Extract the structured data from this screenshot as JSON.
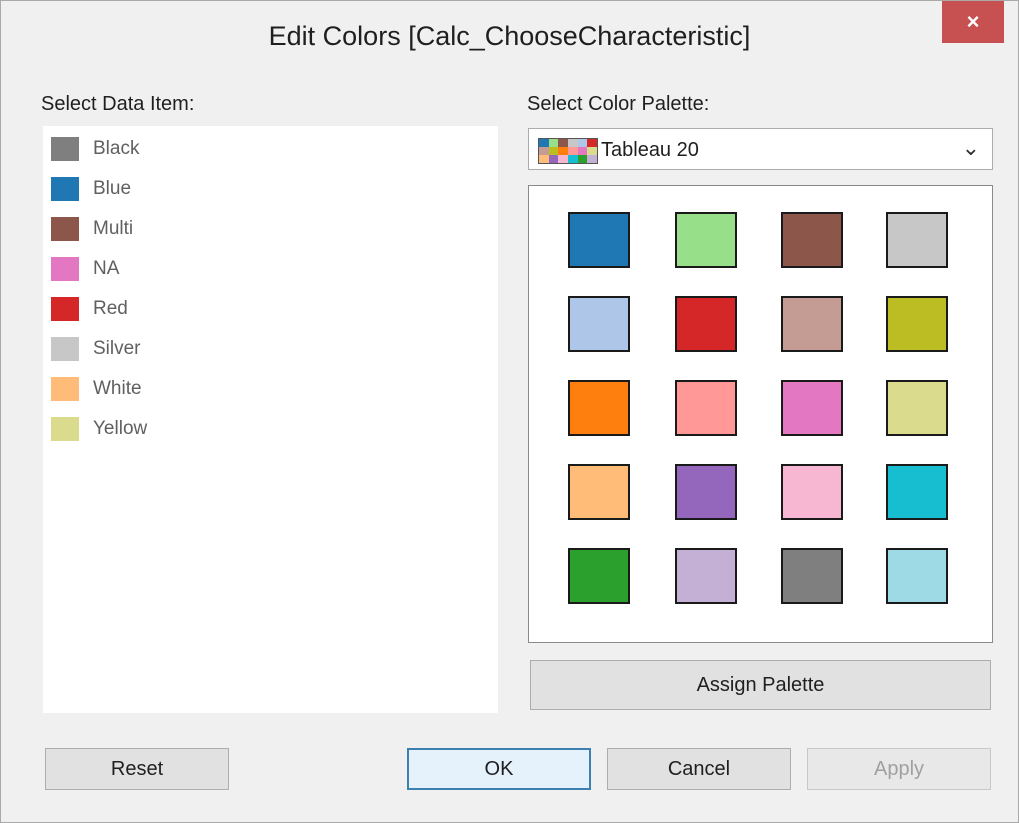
{
  "dialog": {
    "title": "Edit Colors [Calc_ChooseCharacteristic]",
    "close_label": "×"
  },
  "data_items": {
    "label": "Select Data Item:",
    "items": [
      {
        "label": "Black",
        "color": "#7f7f7f"
      },
      {
        "label": "Blue",
        "color": "#1f77b4"
      },
      {
        "label": "Multi",
        "color": "#8c564b"
      },
      {
        "label": "NA",
        "color": "#e377c2"
      },
      {
        "label": "Red",
        "color": "#d62728"
      },
      {
        "label": "Silver",
        "color": "#c7c7c7"
      },
      {
        "label": "White",
        "color": "#ffbb78"
      },
      {
        "label": "Yellow",
        "color": "#dbdb8d"
      }
    ]
  },
  "palette": {
    "label": "Select Color Palette:",
    "selected": "Tableau 20",
    "icon_name": "palette-preview-icon",
    "chevron_icon": "chevron-down-icon",
    "swatches": [
      "#1f77b4",
      "#98df8a",
      "#8c564b",
      "#c7c7c7",
      "#aec7e8",
      "#d62728",
      "#c49c94",
      "#bcbd22",
      "#ff7f0e",
      "#ff9896",
      "#e377c2",
      "#dbdb8d",
      "#ffbb78",
      "#9467bd",
      "#f7b6d2",
      "#17becf",
      "#2ca02c",
      "#c5b0d5",
      "#7f7f7f",
      "#9edae5"
    ],
    "assign_label": "Assign Palette"
  },
  "buttons": {
    "reset": "Reset",
    "ok": "OK",
    "cancel": "Cancel",
    "apply": "Apply"
  }
}
